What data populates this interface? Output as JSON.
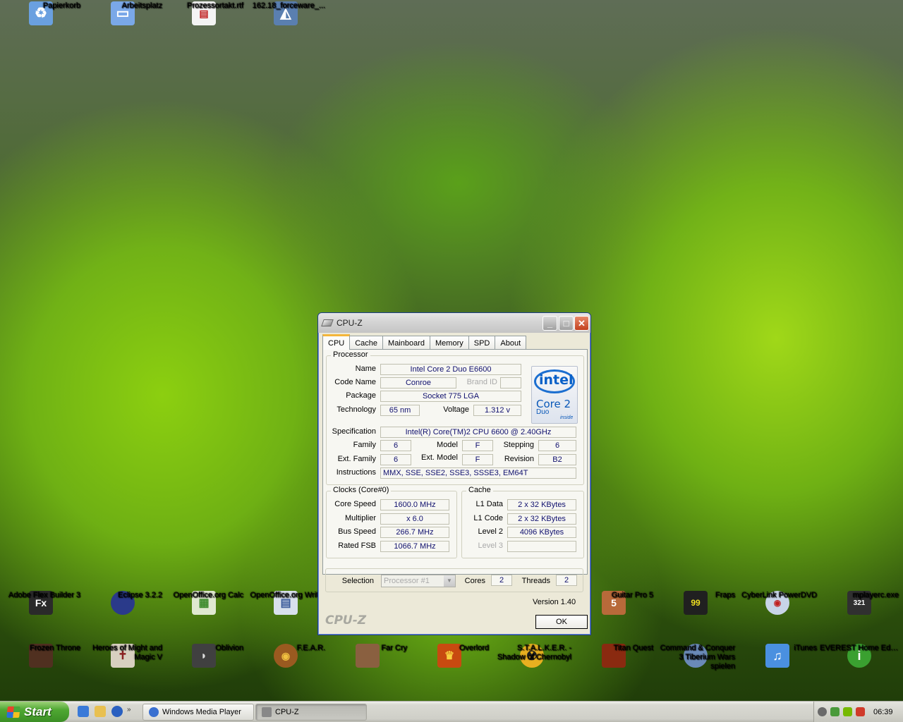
{
  "desktop_icons_top": [
    {
      "label": "Papierkorb",
      "icon": "recycle-bin-icon",
      "color": "#6aa0e0"
    },
    {
      "label": "Arbeitsplatz",
      "icon": "computer-icon",
      "color": "#7aa8e8"
    },
    {
      "label": "Prozessortakt.rtf",
      "icon": "document-icon",
      "color": "#f4f4f4"
    },
    {
      "label": "162.18_forceware_...",
      "icon": "installer-icon",
      "color": "#5a7fb0"
    }
  ],
  "desktop_icons_row1": [
    {
      "label": "Adobe Flex Builder 3",
      "icon": "flex-builder-icon",
      "glyph": "Fx",
      "color": "#2a2a2a"
    },
    {
      "label": "Eclipse 3.2.2",
      "icon": "eclipse-icon",
      "glyph": "",
      "color": "#2a3a8a"
    },
    {
      "label": "OpenOffice.org Calc",
      "icon": "openoffice-calc-icon",
      "glyph": "",
      "color": "#dfe8d0"
    },
    {
      "label": "OpenOffice.org Writer",
      "icon": "openoffice-writer-icon",
      "glyph": "",
      "color": "#d8e0ec"
    },
    {
      "label": "Guitar Pro 5",
      "icon": "guitar-pro-icon",
      "glyph": "",
      "color": "#b86a3a"
    },
    {
      "label": "Fraps",
      "icon": "fraps-icon",
      "glyph": "99",
      "color": "#202020"
    },
    {
      "label": "CyberLink PowerDVD",
      "icon": "powerdvd-icon",
      "glyph": "",
      "color": "#c8d4e8"
    },
    {
      "label": "mplayerc.exe",
      "icon": "mplayer-icon",
      "glyph": "321",
      "color": "#303030"
    }
  ],
  "desktop_icons_row2": [
    {
      "label": "Frozen Throne",
      "icon": "frozen-throne-icon",
      "color": "#503020"
    },
    {
      "label": "Heroes of Might and Magic V",
      "icon": "heroes-icon",
      "color": "#d8d0c0"
    },
    {
      "label": "Oblivion",
      "icon": "oblivion-icon",
      "color": "#404040"
    },
    {
      "label": "F.E.A.R.",
      "icon": "fear-icon",
      "color": "#9a5a20"
    },
    {
      "label": "Far Cry",
      "icon": "far-cry-icon",
      "color": "#8a6040"
    },
    {
      "label": "Overlord",
      "icon": "overlord-icon",
      "color": "#c84a10"
    },
    {
      "label": "S.T.A.L.K.E.R. - Shadow of Chernobyl",
      "icon": "stalker-icon",
      "color": "#e8b020"
    },
    {
      "label": "Titan Quest",
      "icon": "titan-quest-icon",
      "color": "#8a2a10"
    },
    {
      "label": "Command & Conquer 3 Tiberium Wars spielen",
      "icon": "cnc3-icon",
      "color": "#6a8ab8"
    },
    {
      "label": "iTunes",
      "icon": "itunes-icon",
      "color": "#4a90e0"
    },
    {
      "label": "EVEREST Home Edition",
      "icon": "everest-icon",
      "glyph": "i",
      "color": "#3aa030"
    }
  ],
  "cpuz": {
    "title": "CPU-Z",
    "tabs": [
      "CPU",
      "Cache",
      "Mainboard",
      "Memory",
      "SPD",
      "About"
    ],
    "processor": {
      "group_title": "Processor",
      "name_label": "Name",
      "name": "Intel Core 2 Duo E6600",
      "codename_label": "Code Name",
      "codename": "Conroe",
      "brandid_label": "Brand ID",
      "brandid": "",
      "package_label": "Package",
      "package": "Socket 775 LGA",
      "technology_label": "Technology",
      "technology": "65 nm",
      "voltage_label": "Voltage",
      "voltage": "1.312 v",
      "spec_label": "Specification",
      "spec": "Intel(R) Core(TM)2 CPU          6600  @ 2.40GHz",
      "family_label": "Family",
      "family": "6",
      "model_label": "Model",
      "model": "F",
      "stepping_label": "Stepping",
      "stepping": "6",
      "extfamily_label": "Ext. Family",
      "extfamily": "6",
      "extmodel_label": "Ext. Model",
      "extmodel": "F",
      "revision_label": "Revision",
      "revision": "B2",
      "instructions_label": "Instructions",
      "instructions": "MMX, SSE, SSE2, SSE3, SSSE3, EM64T"
    },
    "logo": {
      "brand": "intel",
      "line1": "Core 2",
      "line2": "Duo",
      "tag": "inside"
    },
    "clocks": {
      "group_title": "Clocks (Core#0)",
      "corespeed_label": "Core Speed",
      "corespeed": "1600.0 MHz",
      "multiplier_label": "Multiplier",
      "multiplier": "x 6.0",
      "busspeed_label": "Bus Speed",
      "busspeed": "266.7 MHz",
      "ratedfsb_label": "Rated FSB",
      "ratedfsb": "1066.7 MHz"
    },
    "cache": {
      "group_title": "Cache",
      "l1data_label": "L1 Data",
      "l1data": "2 x 32 KBytes",
      "l1code_label": "L1 Code",
      "l1code": "2 x 32 KBytes",
      "level2_label": "Level 2",
      "level2": "4096 KBytes",
      "level3_label": "Level 3",
      "level3": ""
    },
    "selection": {
      "label": "Selection",
      "value": "Processor #1",
      "cores_label": "Cores",
      "cores": "2",
      "threads_label": "Threads",
      "threads": "2"
    },
    "version": "Version 1.40",
    "brand_watermark": "CPU-Z",
    "ok_label": "OK"
  },
  "taskbar": {
    "start_label": "Start",
    "items": [
      {
        "label": "Windows Media Player",
        "active": false
      },
      {
        "label": "CPU-Z",
        "active": true
      }
    ],
    "clock": "06:39"
  }
}
